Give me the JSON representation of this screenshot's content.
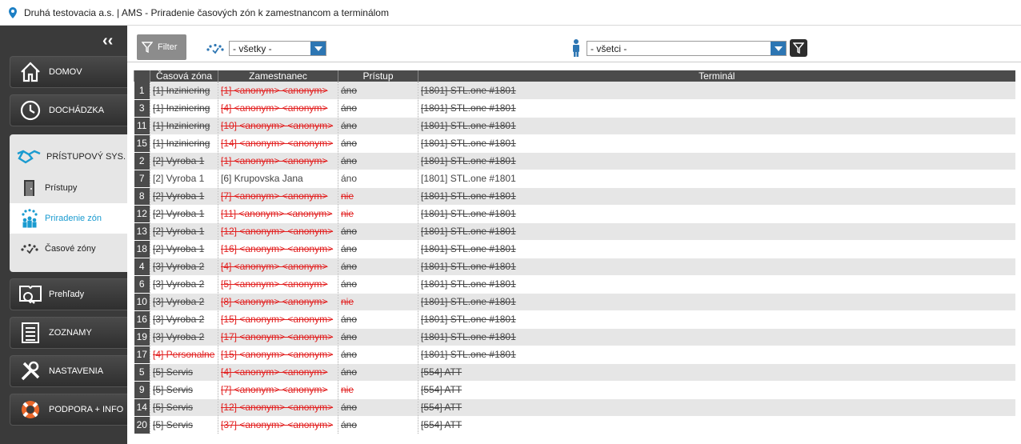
{
  "window": {
    "title": "Druhá testovacia a.s. | AMS - Priradenie časových zón k zamestnancom a terminálom"
  },
  "sidebar": {
    "top_items": [
      {
        "label": "DOMOV",
        "icon": "home-icon"
      },
      {
        "label": "DOCHÁDZKA",
        "icon": "clock-icon"
      }
    ],
    "section": {
      "label": "PRÍSTUPOVÝ SYS.",
      "icon": "handshake-icon",
      "items": [
        {
          "label": "Prístupy",
          "icon": "door-icon",
          "active": false
        },
        {
          "label": "Priradenie zón",
          "icon": "zone-assign-icon",
          "active": true
        },
        {
          "label": "Časové zóny",
          "icon": "time-zone-icon",
          "active": false
        }
      ]
    },
    "bottom_items": [
      {
        "label": "Prehľady",
        "icon": "book-search-icon"
      },
      {
        "label": "ZOZNAMY",
        "icon": "list-icon"
      },
      {
        "label": "NASTAVENIA",
        "icon": "tools-icon"
      },
      {
        "label": "PODPORA + INFO",
        "icon": "lifebuoy-icon"
      }
    ]
  },
  "toolbar": {
    "filter_label": "Filter",
    "zone_select": "- všetky -",
    "person_select": "- všetci -"
  },
  "table": {
    "columns": [
      "Časová zóna",
      "Zamestnanec",
      "Prístup",
      "Terminál"
    ],
    "rows": [
      {
        "n": "1",
        "zone": "[1] Inziniering",
        "emp": "[1] <anonym> <anonym>",
        "acc": "áno",
        "term": "[1801] STL.one #1801",
        "struck": true,
        "red_zone": false,
        "red_emp": true,
        "red_acc": false
      },
      {
        "n": "3",
        "zone": "[1] Inziniering",
        "emp": "[4] <anonym> <anonym>",
        "acc": "áno",
        "term": "[1801] STL.one #1801",
        "struck": true,
        "red_zone": false,
        "red_emp": true,
        "red_acc": false
      },
      {
        "n": "11",
        "zone": "[1] Inziniering",
        "emp": "[10] <anonym> <anonym>",
        "acc": "áno",
        "term": "[1801] STL.one #1801",
        "struck": true,
        "red_zone": false,
        "red_emp": true,
        "red_acc": false
      },
      {
        "n": "15",
        "zone": "[1] Inziniering",
        "emp": "[14] <anonym> <anonym>",
        "acc": "áno",
        "term": "[1801] STL.one #1801",
        "struck": true,
        "red_zone": false,
        "red_emp": true,
        "red_acc": false
      },
      {
        "n": "2",
        "zone": "[2] Vyroba 1",
        "emp": "[1] <anonym> <anonym>",
        "acc": "áno",
        "term": "[1801] STL.one #1801",
        "struck": true,
        "red_zone": false,
        "red_emp": true,
        "red_acc": false
      },
      {
        "n": "7",
        "zone": "[2] Vyroba 1",
        "emp": "[6] Krupovska Jana",
        "acc": "áno",
        "term": "[1801] STL.one #1801",
        "struck": false,
        "red_zone": false,
        "red_emp": false,
        "red_acc": false
      },
      {
        "n": "8",
        "zone": "[2] Vyroba 1",
        "emp": "[7] <anonym> <anonym>",
        "acc": "nie",
        "term": "[1801] STL.one #1801",
        "struck": true,
        "red_zone": false,
        "red_emp": true,
        "red_acc": true
      },
      {
        "n": "12",
        "zone": "[2] Vyroba 1",
        "emp": "[11] <anonym> <anonym>",
        "acc": "nie",
        "term": "[1801] STL.one #1801",
        "struck": true,
        "red_zone": false,
        "red_emp": true,
        "red_acc": true
      },
      {
        "n": "13",
        "zone": "[2] Vyroba 1",
        "emp": "[12] <anonym> <anonym>",
        "acc": "áno",
        "term": "[1801] STL.one #1801",
        "struck": true,
        "red_zone": false,
        "red_emp": true,
        "red_acc": false
      },
      {
        "n": "18",
        "zone": "[2] Vyroba 1",
        "emp": "[16] <anonym> <anonym>",
        "acc": "áno",
        "term": "[1801] STL.one #1801",
        "struck": true,
        "red_zone": false,
        "red_emp": true,
        "red_acc": false
      },
      {
        "n": "4",
        "zone": "[3] Vyroba 2",
        "emp": "[4] <anonym> <anonym>",
        "acc": "áno",
        "term": "[1801] STL.one #1801",
        "struck": true,
        "red_zone": false,
        "red_emp": true,
        "red_acc": false
      },
      {
        "n": "6",
        "zone": "[3] Vyroba 2",
        "emp": "[5] <anonym> <anonym>",
        "acc": "áno",
        "term": "[1801] STL.one #1801",
        "struck": true,
        "red_zone": false,
        "red_emp": true,
        "red_acc": false
      },
      {
        "n": "10",
        "zone": "[3] Vyroba 2",
        "emp": "[8] <anonym> <anonym>",
        "acc": "nie",
        "term": "[1801] STL.one #1801",
        "struck": true,
        "red_zone": false,
        "red_emp": true,
        "red_acc": true
      },
      {
        "n": "16",
        "zone": "[3] Vyroba 2",
        "emp": "[15] <anonym> <anonym>",
        "acc": "áno",
        "term": "[1801] STL.one #1801",
        "struck": true,
        "red_zone": false,
        "red_emp": true,
        "red_acc": false
      },
      {
        "n": "19",
        "zone": "[3] Vyroba 2",
        "emp": "[17] <anonym> <anonym>",
        "acc": "áno",
        "term": "[1801] STL.one #1801",
        "struck": true,
        "red_zone": false,
        "red_emp": true,
        "red_acc": false
      },
      {
        "n": "17",
        "zone": "[4] Personalne",
        "emp": "[15] <anonym> <anonym>",
        "acc": "áno",
        "term": "[1801] STL.one #1801",
        "struck": true,
        "red_zone": true,
        "red_emp": true,
        "red_acc": false
      },
      {
        "n": "5",
        "zone": "[5] Servis",
        "emp": "[4] <anonym> <anonym>",
        "acc": "áno",
        "term": "[554] ATT",
        "struck": true,
        "red_zone": false,
        "red_emp": true,
        "red_acc": false
      },
      {
        "n": "9",
        "zone": "[5] Servis",
        "emp": "[7] <anonym> <anonym>",
        "acc": "nie",
        "term": "[554] ATT",
        "struck": true,
        "red_zone": false,
        "red_emp": true,
        "red_acc": true
      },
      {
        "n": "14",
        "zone": "[5] Servis",
        "emp": "[12] <anonym> <anonym>",
        "acc": "áno",
        "term": "[554] ATT",
        "struck": true,
        "red_zone": false,
        "red_emp": true,
        "red_acc": false
      },
      {
        "n": "20",
        "zone": "[5] Servis",
        "emp": "[37] <anonym> <anonym>",
        "acc": "áno",
        "term": "[554] ATT",
        "struck": true,
        "red_zone": false,
        "red_emp": true,
        "red_acc": false
      }
    ]
  },
  "colors": {
    "accent": "#1a9bd0",
    "strike_red": "#e21f1f",
    "select_arrow": "#2d76b3",
    "header_bg": "#4b4b4b"
  }
}
